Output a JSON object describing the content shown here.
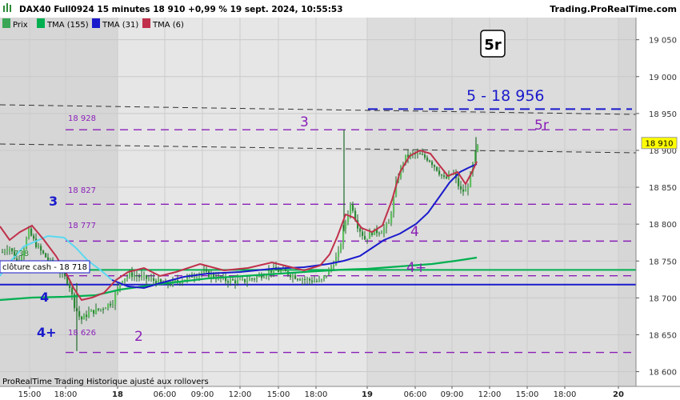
{
  "header": {
    "instrument": "DAX40 Full0924 15 minutes 18 910 +0,99 % 19 sept. 2024, 10:55:53",
    "site": "Trading.ProRealTime.com"
  },
  "legend": [
    {
      "label": "Prix",
      "color": "#3aa655"
    },
    {
      "label": "TMA (155)",
      "color": "#00b050"
    },
    {
      "label": "TMA (31)",
      "color": "#1a1acc"
    },
    {
      "label": "TMA (6)",
      "color": "#c0304a"
    }
  ],
  "footer": {
    "text": "ProRealTime Trading  Historique ajusté aux rollovers"
  },
  "price_box": {
    "value": "18 910",
    "color": "#ffff00"
  },
  "annotations": {
    "wave_5r_box": "5r",
    "target": "5 - 18 956",
    "w3_left": "3",
    "w3_top": "3",
    "w4_left": "4",
    "w4plus_left": "4+",
    "w2": "2",
    "w4_right": "4",
    "w4plus_right": "4+",
    "w5r_right": "5r",
    "cloture": "clôture cash -  18 718",
    "lvl_928": "18 928",
    "lvl_827": "18 827",
    "lvl_777": "18 777",
    "lvl_738": "738",
    "lvl_626": "18 626"
  },
  "chart_data": {
    "type": "candlestick",
    "y_axis": {
      "ylim": [
        18580,
        19080
      ],
      "ticks": [
        18600,
        18650,
        18700,
        18750,
        18800,
        18850,
        18900,
        18950,
        19000,
        19050
      ],
      "tick_labels": [
        "18 600",
        "18 650",
        "18 700",
        "18 750",
        "18 800",
        "18 850",
        "18 900",
        "18 950",
        "19 000",
        "19 050"
      ]
    },
    "x_axis": {
      "tick_labels": [
        "15:00",
        "18:00",
        "18",
        "06:00",
        "09:00",
        "12:00",
        "15:00",
        "18:00",
        "19",
        "06:00",
        "09:00",
        "12:00",
        "15:00",
        "18:00",
        "20"
      ],
      "bold": [
        false,
        false,
        true,
        false,
        false,
        false,
        false,
        false,
        true,
        false,
        false,
        false,
        false,
        false,
        true
      ]
    },
    "levels": [
      {
        "value": 18956,
        "color": "#1a1acc",
        "style": "dashed"
      },
      {
        "value": 18928,
        "color": "#8a1fb8",
        "style": "dashed"
      },
      {
        "value": 18827,
        "color": "#8a1fb8",
        "style": "dashed"
      },
      {
        "value": 18777,
        "color": "#8a1fb8",
        "style": "dashed"
      },
      {
        "value": 18738,
        "color": "#00b050",
        "style": "solid"
      },
      {
        "value": 18730,
        "color": "#8a1fb8",
        "style": "dashed"
      },
      {
        "value": 18718,
        "color": "#1a1acc",
        "style": "solid"
      },
      {
        "value": 18626,
        "color": "#8a1fb8",
        "style": "dashed"
      }
    ],
    "series": [
      {
        "name": "Prix",
        "kind": "candles"
      },
      {
        "name": "TMA (155)"
      },
      {
        "name": "TMA (31)"
      },
      {
        "name": "TMA (6)"
      }
    ]
  }
}
